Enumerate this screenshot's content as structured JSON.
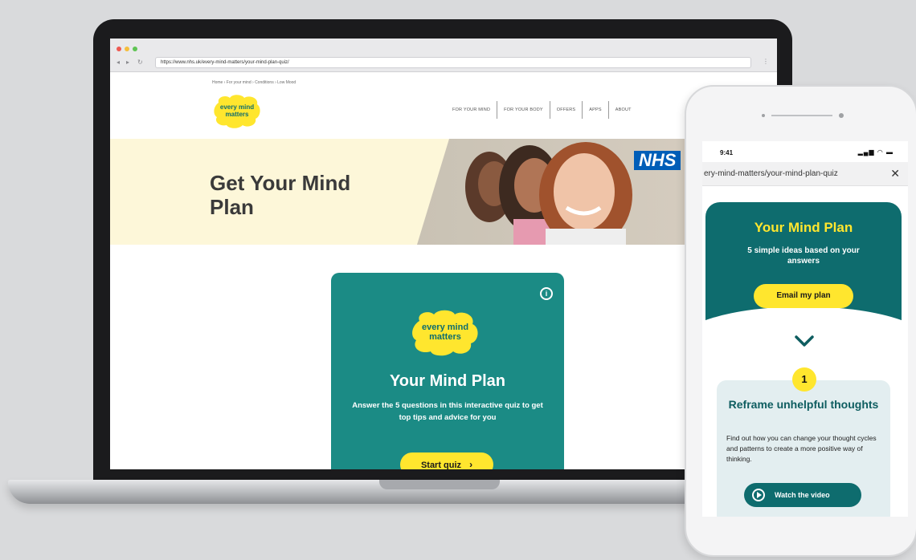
{
  "laptop": {
    "browser": {
      "url": "https://www.nhs.uk/every-mind-matters/your-mind-plan-quiz/",
      "nav_back": "◂",
      "nav_forward": "▸",
      "nav_reload": "↻",
      "menu": "⋮"
    },
    "site": {
      "breadcrumb": "Home › For your mind › Conditions › Low Mood",
      "logo_line1": "every mind",
      "logo_line2": "matters",
      "nav": [
        "FOR YOUR MIND",
        "FOR YOUR BODY",
        "OFFERS",
        "APPS",
        "ABOUT"
      ]
    },
    "hero": {
      "title": "Get Your Mind Plan",
      "badge": "NHS"
    },
    "quiz_card": {
      "info_icon": "i",
      "logo_line1": "every mind",
      "logo_line2": "matters",
      "title": "Your Mind Plan",
      "text": "Answer the 5 questions in this interactive quiz to get top tips and advice for you",
      "button": "Start quiz",
      "button_icon": "›"
    }
  },
  "phone": {
    "status": {
      "time": "9:41",
      "icons": "▂▄▆ ◠ ▬"
    },
    "url": "ery-mind-matters/your-mind-plan-quiz",
    "close": "✕",
    "plan": {
      "title": "Your Mind Plan",
      "subtitle": "5 simple ideas based on your answers",
      "button": "Email my plan"
    },
    "step": {
      "number": "1",
      "title": "Reframe unhelpful thoughts",
      "text": "Find out how you can change your thought cycles and patterns to create a more positive way of thinking.",
      "button": "Watch the video"
    }
  },
  "colors": {
    "teal": "#1b8b85",
    "dark_teal": "#0e6c6e",
    "yellow": "#ffe62e",
    "nhs_blue": "#005eb8",
    "hero_bg": "#fdf7d9"
  }
}
